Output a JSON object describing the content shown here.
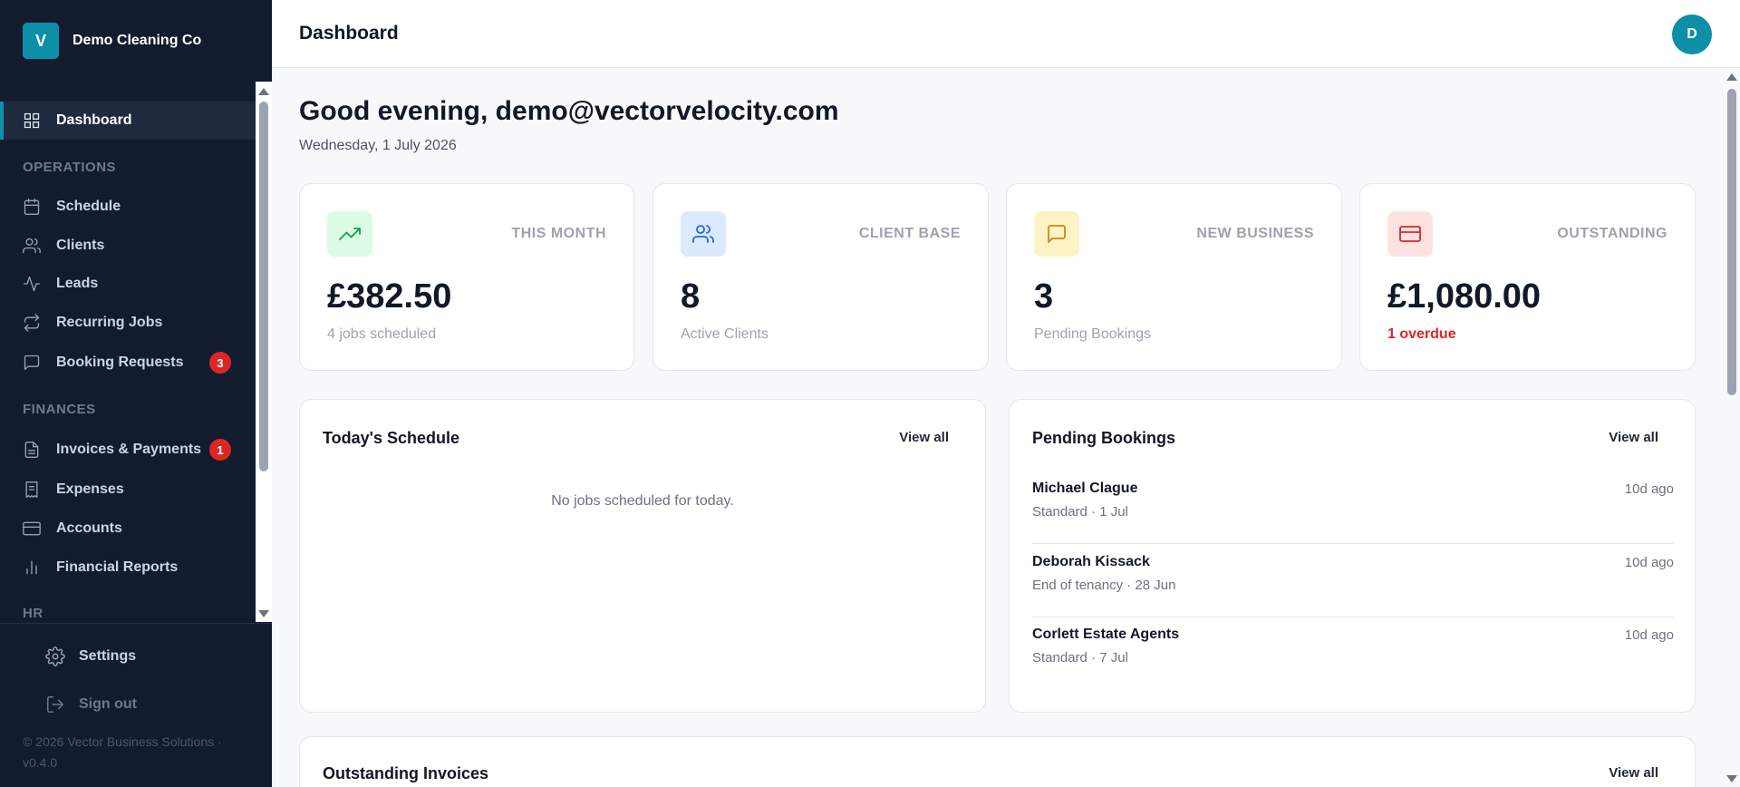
{
  "brand": {
    "logo_letter": "V",
    "name": "Demo Cleaning Co"
  },
  "sidebar": {
    "dashboard": "Dashboard",
    "sections": {
      "operations": "OPERATIONS",
      "finances": "FINANCES",
      "hr": "HR"
    },
    "operations": [
      {
        "label": "Schedule",
        "icon": "calendar-icon"
      },
      {
        "label": "Clients",
        "icon": "users-icon"
      },
      {
        "label": "Leads",
        "icon": "activity-icon"
      },
      {
        "label": "Recurring Jobs",
        "icon": "repeat-icon"
      },
      {
        "label": "Booking Requests",
        "icon": "message-icon",
        "badge": "3"
      }
    ],
    "finances": [
      {
        "label": "Invoices & Payments",
        "icon": "file-text-icon",
        "badge": "1"
      },
      {
        "label": "Expenses",
        "icon": "receipt-icon"
      },
      {
        "label": "Accounts",
        "icon": "credit-card-icon"
      },
      {
        "label": "Financial Reports",
        "icon": "bar-chart-icon"
      }
    ],
    "settings": "Settings",
    "sign_out": "Sign out",
    "copyright": "© 2026 Vector Business Solutions · v0.4.0"
  },
  "header": {
    "title": "Dashboard",
    "avatar_letter": "D"
  },
  "greeting": {
    "text": "Good evening, demo@vectorvelocity.com",
    "date": "Wednesday, 1 July 2026"
  },
  "stats": [
    {
      "label": "THIS MONTH",
      "value": "£382.50",
      "sub": "4 jobs scheduled",
      "icon": "trending-up-icon",
      "color": "#16a34a",
      "bg": "#dcfce7"
    },
    {
      "label": "CLIENT BASE",
      "value": "8",
      "sub": "Active Clients",
      "icon": "users-icon",
      "color": "#2563eb",
      "bg": "#dbeafe"
    },
    {
      "label": "NEW BUSINESS",
      "value": "3",
      "sub": "Pending Bookings",
      "icon": "message-icon",
      "color": "#ca8a04",
      "bg": "#fef3c7"
    },
    {
      "label": "OUTSTANDING",
      "value": "£1,080.00",
      "sub": "1 overdue",
      "icon": "credit-card-icon",
      "color": "#dc2626",
      "bg": "#fee2e2"
    }
  ],
  "schedule": {
    "title": "Today's Schedule",
    "view_all": "View all",
    "empty": "No jobs scheduled for today."
  },
  "pending": {
    "title": "Pending Bookings",
    "view_all": "View all",
    "items": [
      {
        "name": "Michael Clague",
        "sub": "Standard · 1 Jul",
        "time": "10d ago"
      },
      {
        "name": "Deborah Kissack",
        "sub": "End of tenancy · 28 Jun",
        "time": "10d ago"
      },
      {
        "name": "Corlett Estate Agents",
        "sub": "Standard · 7 Jul",
        "time": "10d ago"
      }
    ]
  },
  "outstanding": {
    "title": "Outstanding Invoices",
    "view_all": "View all"
  }
}
